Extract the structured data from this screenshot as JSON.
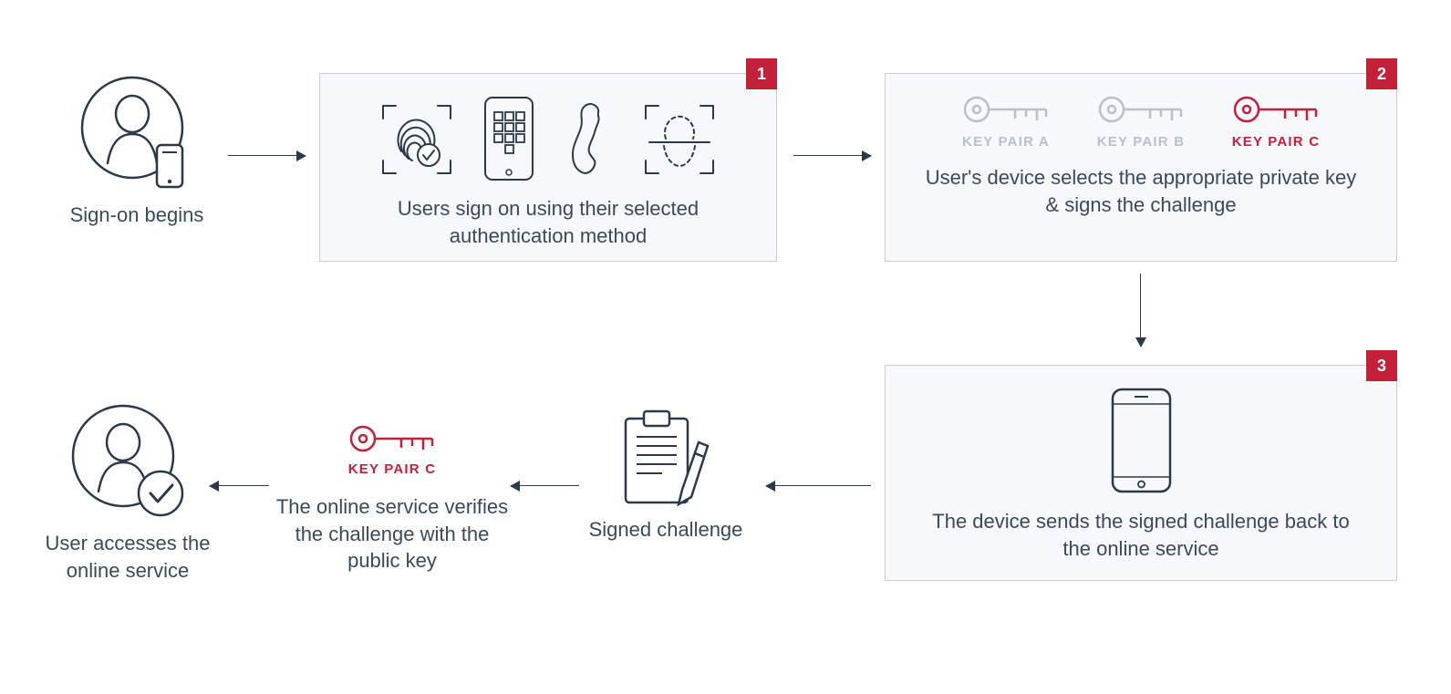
{
  "step_start": {
    "caption": "Sign-on begins"
  },
  "step1": {
    "badge": "1",
    "caption": "Users sign on using their selected authentication method"
  },
  "step2": {
    "badge": "2",
    "caption": "User's device selects the appropriate private key & signs the challenge",
    "keys": [
      {
        "label": "KEY PAIR A",
        "selected": false
      },
      {
        "label": "KEY PAIR B",
        "selected": false
      },
      {
        "label": "KEY PAIR C",
        "selected": true
      }
    ]
  },
  "step3": {
    "badge": "3",
    "caption": "The device sends the signed challenge back to the online service"
  },
  "signed": {
    "caption": "Signed challenge"
  },
  "verify": {
    "key_label": "KEY PAIR C",
    "caption": "The online service verifies the challenge with the public key"
  },
  "end": {
    "caption": "User accesses the online service"
  },
  "colors": {
    "accent": "#c5203a",
    "ink": "#2b3a4a"
  }
}
